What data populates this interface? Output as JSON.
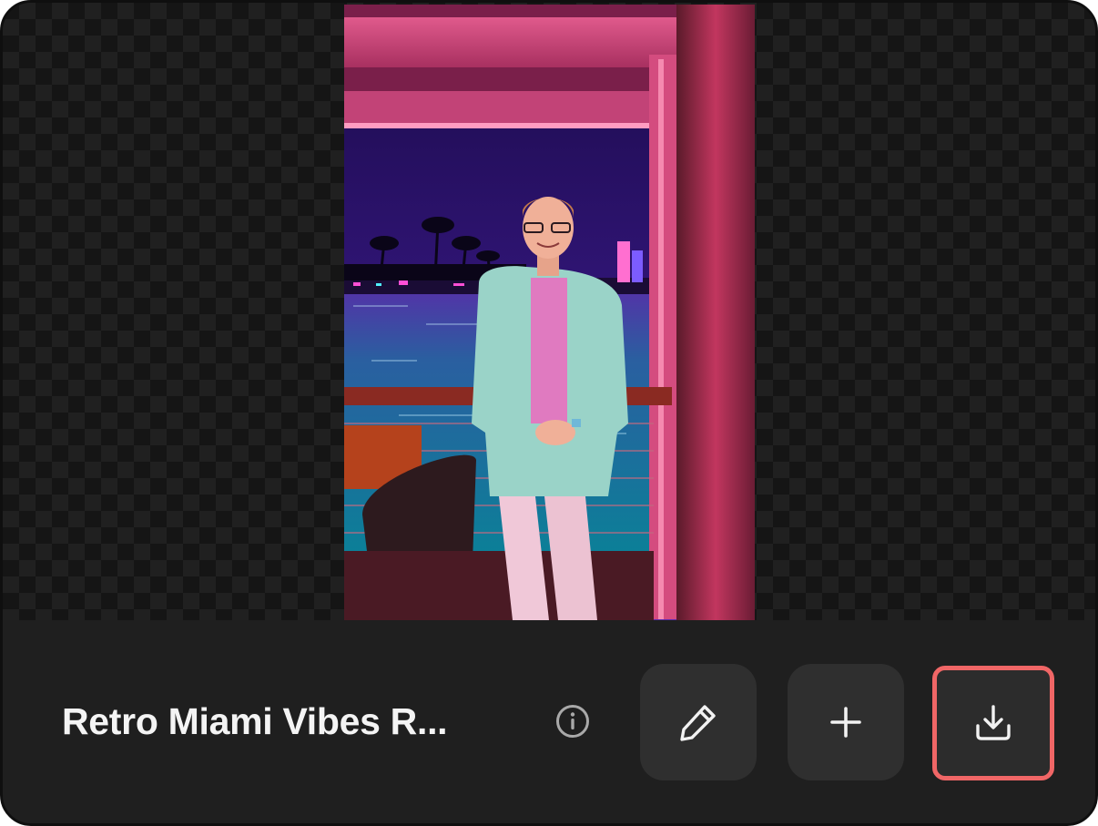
{
  "card": {
    "title": "Retro Miami Vibes R..."
  },
  "actions": {
    "info_icon": "info-circle",
    "edit_icon": "pencil",
    "add_icon": "plus",
    "download_icon": "download-tray"
  },
  "colors": {
    "accent_highlight": "#f06666",
    "bar_background": "#1f1f1f",
    "button_background": "#2f2f2f"
  }
}
